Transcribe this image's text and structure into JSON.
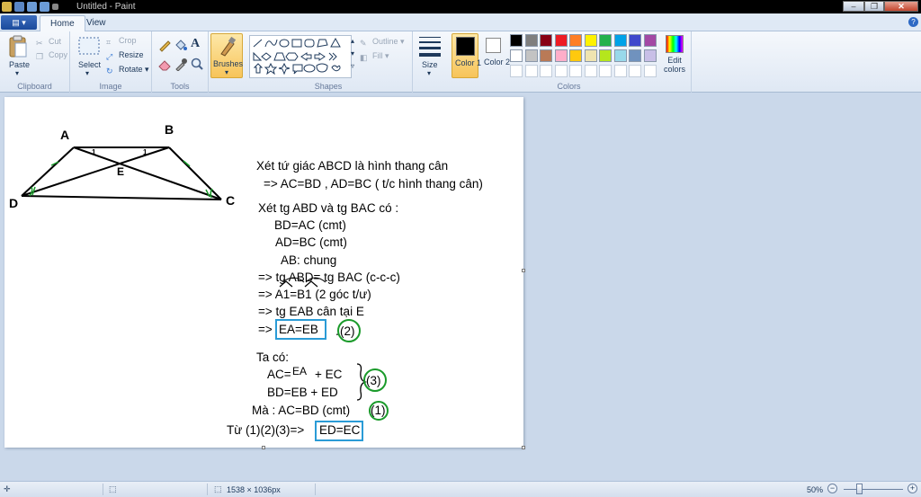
{
  "window": {
    "title": "Untitled - Paint"
  },
  "tabs": [
    {
      "label": "Home"
    },
    {
      "label": "View"
    }
  ],
  "ribbon": {
    "clipboard": {
      "group_label": "Clipboard",
      "paste": "Paste",
      "cut": "Cut",
      "copy": "Copy"
    },
    "image": {
      "group_label": "Image",
      "select": "Select",
      "crop": "Crop",
      "resize": "Resize",
      "rotate": "Rotate"
    },
    "tools": {
      "group_label": "Tools"
    },
    "brushes": {
      "label": "Brushes"
    },
    "shapes": {
      "group_label": "Shapes",
      "outline": "Outline",
      "fill": "Fill"
    },
    "size": {
      "label": "Size"
    },
    "colors": {
      "group_label": "Colors",
      "color1": "Color 1",
      "color2": "Color 2",
      "edit_colors": "Edit colors",
      "color1_value": "#000000",
      "color2_value": "#ffffff",
      "palette_row1": [
        "#000000",
        "#7f7f7f",
        "#880015",
        "#ed1c24",
        "#ff7f27",
        "#fff200",
        "#22b14c",
        "#00a2e8",
        "#3f48cc",
        "#a349a4"
      ],
      "palette_row2": [
        "#ffffff",
        "#c3c3c3",
        "#b97a57",
        "#ffaec9",
        "#ffc90e",
        "#efe4b0",
        "#b5e61d",
        "#99d9ea",
        "#7092be",
        "#c8bfe7"
      ]
    }
  },
  "drawing": {
    "labels": {
      "A": "A",
      "B": "B",
      "C": "C",
      "D": "D",
      "E": "E",
      "angle1": "1"
    },
    "lines": [
      "Xét tứ giác ABCD là hình thang cân",
      "=> AC=BD , AD=BC ( t/c hình thang cân)",
      "Xét tg ABD và tg BAC có :",
      "BD=AC (cmt)",
      "AD=BC (cmt)",
      "AB: chung",
      "=> tg ABD= tg BAC (c-c-c)",
      "=> A1=B1 (2 góc t/ư)",
      "=> tg EAB cân tại E",
      "=>",
      "EA=EB",
      ".",
      "(2)",
      "Ta có:",
      "AC=",
      "EA",
      "+ EC",
      "BD=EB + ED",
      "(3)",
      "Mà : AC=BD (cmt)",
      "(1)",
      "Từ (1)(2)(3)=>",
      "ED=EC"
    ]
  },
  "status": {
    "dimensions": "1538 × 1036px",
    "zoom": "50%"
  }
}
